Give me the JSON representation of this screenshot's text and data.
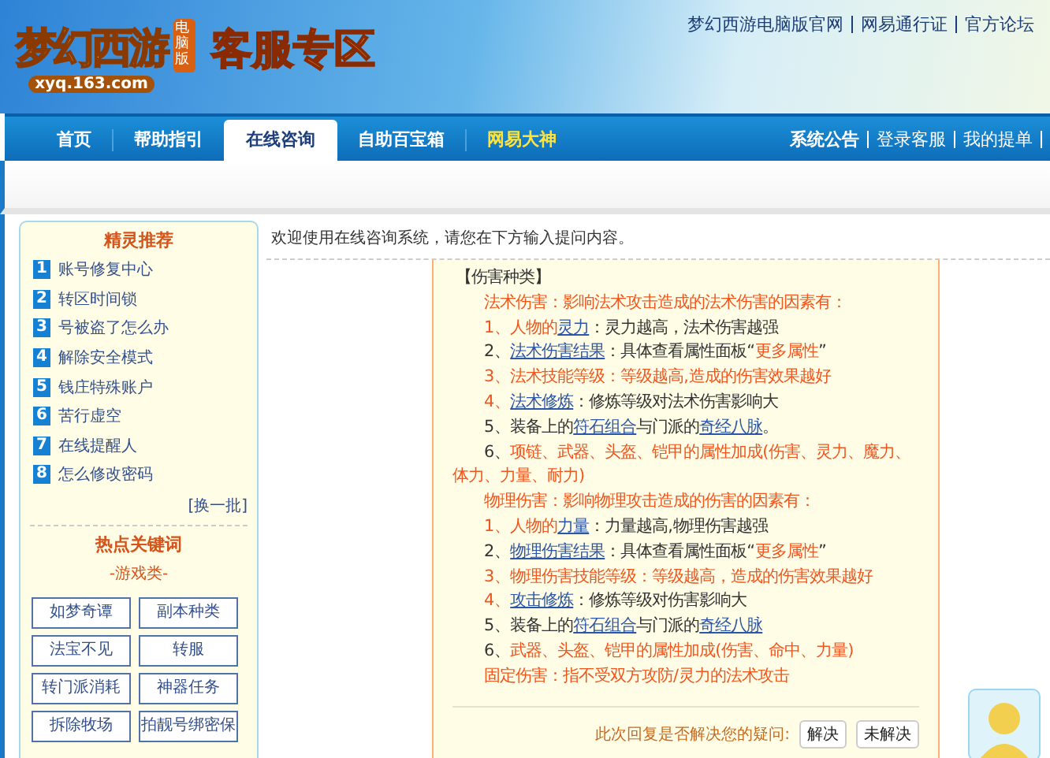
{
  "header": {
    "logo_text": "梦幻西游",
    "logo_badge": "电脑版",
    "logo_url": "xyq.163.com",
    "section_title": "客服专区",
    "links": [
      "梦幻西游电脑版官网",
      "网易通行证",
      "官方论坛"
    ]
  },
  "nav": {
    "tabs": [
      {
        "label": "首页",
        "selected": false,
        "kind": "normal"
      },
      {
        "label": "帮助指引",
        "selected": false,
        "kind": "normal"
      },
      {
        "label": "在线咨询",
        "selected": true,
        "kind": "normal"
      },
      {
        "label": "自助百宝箱",
        "selected": false,
        "kind": "normal"
      },
      {
        "label": "网易大神",
        "selected": false,
        "kind": "highlight"
      }
    ],
    "right_links": [
      {
        "label": "系统公告",
        "kind": "bold"
      },
      {
        "label": "登录客服",
        "kind": "normal"
      },
      {
        "label": "我的提单",
        "kind": "normal"
      }
    ]
  },
  "sidebar": {
    "title": "精灵推荐",
    "items": [
      {
        "number": "1",
        "label": "账号修复中心"
      },
      {
        "number": "2",
        "label": "转区时间锁"
      },
      {
        "number": "3",
        "label": "号被盗了怎么办"
      },
      {
        "number": "4",
        "label": "解除安全模式"
      },
      {
        "number": "5",
        "label": "钱庄特殊账户"
      },
      {
        "number": "6",
        "label": "苦行虚空"
      },
      {
        "number": "7",
        "label": "在线提醒人"
      },
      {
        "number": "8",
        "label": "怎么修改密码"
      }
    ],
    "refresh": "[换一批]",
    "keywords_title": "热点关键词",
    "category": "-游戏类-",
    "keywords": [
      "如梦奇谭",
      "副本种类",
      "法宝不见",
      "转服",
      "转门派消耗",
      "神器任务",
      "拆除牧场",
      "拍靓号绑密保"
    ]
  },
  "content": {
    "welcome": "欢迎使用在线咨询系统，请您在下方输入提问内容。",
    "answer_lines": [
      {
        "kind": "heading",
        "segments": [
          {
            "text": "【伤害种类】",
            "kind": "plain"
          }
        ]
      },
      {
        "kind": "indented",
        "segments": [
          {
            "text": "法术伤害：影响法术攻击造成的法术伤害的因素有：",
            "kind": "red"
          }
        ]
      },
      {
        "kind": "indented",
        "segments": [
          {
            "text": "1、人物的",
            "kind": "red"
          },
          {
            "text": "灵力",
            "kind": "link"
          },
          {
            "text": "：灵力越高，法术伤害越强",
            "kind": "plain"
          }
        ]
      },
      {
        "kind": "indented",
        "segments": [
          {
            "text": "2、",
            "kind": "plain"
          },
          {
            "text": "法术伤害结果",
            "kind": "link"
          },
          {
            "text": "：具体查看属性面板“",
            "kind": "plain"
          },
          {
            "text": "更多属性",
            "kind": "red"
          },
          {
            "text": "”",
            "kind": "plain"
          }
        ]
      },
      {
        "kind": "indented",
        "segments": [
          {
            "text": "3、法术技能等级：等级越高,造成的伤害效果越好",
            "kind": "red"
          }
        ]
      },
      {
        "kind": "indented",
        "segments": [
          {
            "text": "4、",
            "kind": "red"
          },
          {
            "text": "法术修炼",
            "kind": "link"
          },
          {
            "text": "：修炼等级对法术伤害影响大",
            "kind": "plain"
          }
        ]
      },
      {
        "kind": "indented",
        "segments": [
          {
            "text": "5、装备上的",
            "kind": "plain"
          },
          {
            "text": "符石组合",
            "kind": "link"
          },
          {
            "text": "与门派的",
            "kind": "plain"
          },
          {
            "text": "奇经八脉",
            "kind": "link"
          },
          {
            "text": "。",
            "kind": "plain"
          }
        ]
      },
      {
        "kind": "indented",
        "segments": [
          {
            "text": "6、",
            "kind": "plain"
          },
          {
            "text": "项链、武器、头盔、铠甲的属性加成(伤害、灵力、魔力、体力、力量、耐力)",
            "kind": "red"
          }
        ]
      },
      {
        "kind": "indented",
        "segments": [
          {
            "text": "物理伤害：影响物理攻击造成的伤害的因素有：",
            "kind": "red"
          }
        ]
      },
      {
        "kind": "indented",
        "segments": [
          {
            "text": "1、人物的",
            "kind": "red"
          },
          {
            "text": "力量",
            "kind": "link"
          },
          {
            "text": "：力量越高,物理伤害越强",
            "kind": "plain"
          }
        ]
      },
      {
        "kind": "indented",
        "segments": [
          {
            "text": "2、",
            "kind": "plain"
          },
          {
            "text": "物理伤害结果",
            "kind": "link"
          },
          {
            "text": "：具体查看属性面板“",
            "kind": "plain"
          },
          {
            "text": "更多属性",
            "kind": "red"
          },
          {
            "text": "”",
            "kind": "plain"
          }
        ]
      },
      {
        "kind": "indented",
        "segments": [
          {
            "text": "3、物理伤害技能等级：等级越高，造成的伤害效果越好",
            "kind": "red"
          }
        ]
      },
      {
        "kind": "indented",
        "segments": [
          {
            "text": "4、",
            "kind": "red"
          },
          {
            "text": "攻击修炼",
            "kind": "link"
          },
          {
            "text": "：修炼等级对伤害影响大",
            "kind": "plain"
          }
        ]
      },
      {
        "kind": "indented",
        "segments": [
          {
            "text": "5、装备上的",
            "kind": "plain"
          },
          {
            "text": "符石组合",
            "kind": "link"
          },
          {
            "text": "与门派的",
            "kind": "plain"
          },
          {
            "text": "奇经八脉",
            "kind": "link"
          }
        ]
      },
      {
        "kind": "indented",
        "segments": [
          {
            "text": "6、",
            "kind": "plain"
          },
          {
            "text": "武器、头盔、铠甲的属性加成(伤害、命中、力量)",
            "kind": "red"
          }
        ]
      },
      {
        "kind": "indented",
        "segments": [
          {
            "text": "固定伤害：指不受双方攻防/灵力的法术攻击",
            "kind": "red"
          }
        ]
      }
    ],
    "feedback_prompt": "此次回复是否解决您的疑问:",
    "feedback_buttons": [
      "解决",
      "未解决"
    ]
  }
}
